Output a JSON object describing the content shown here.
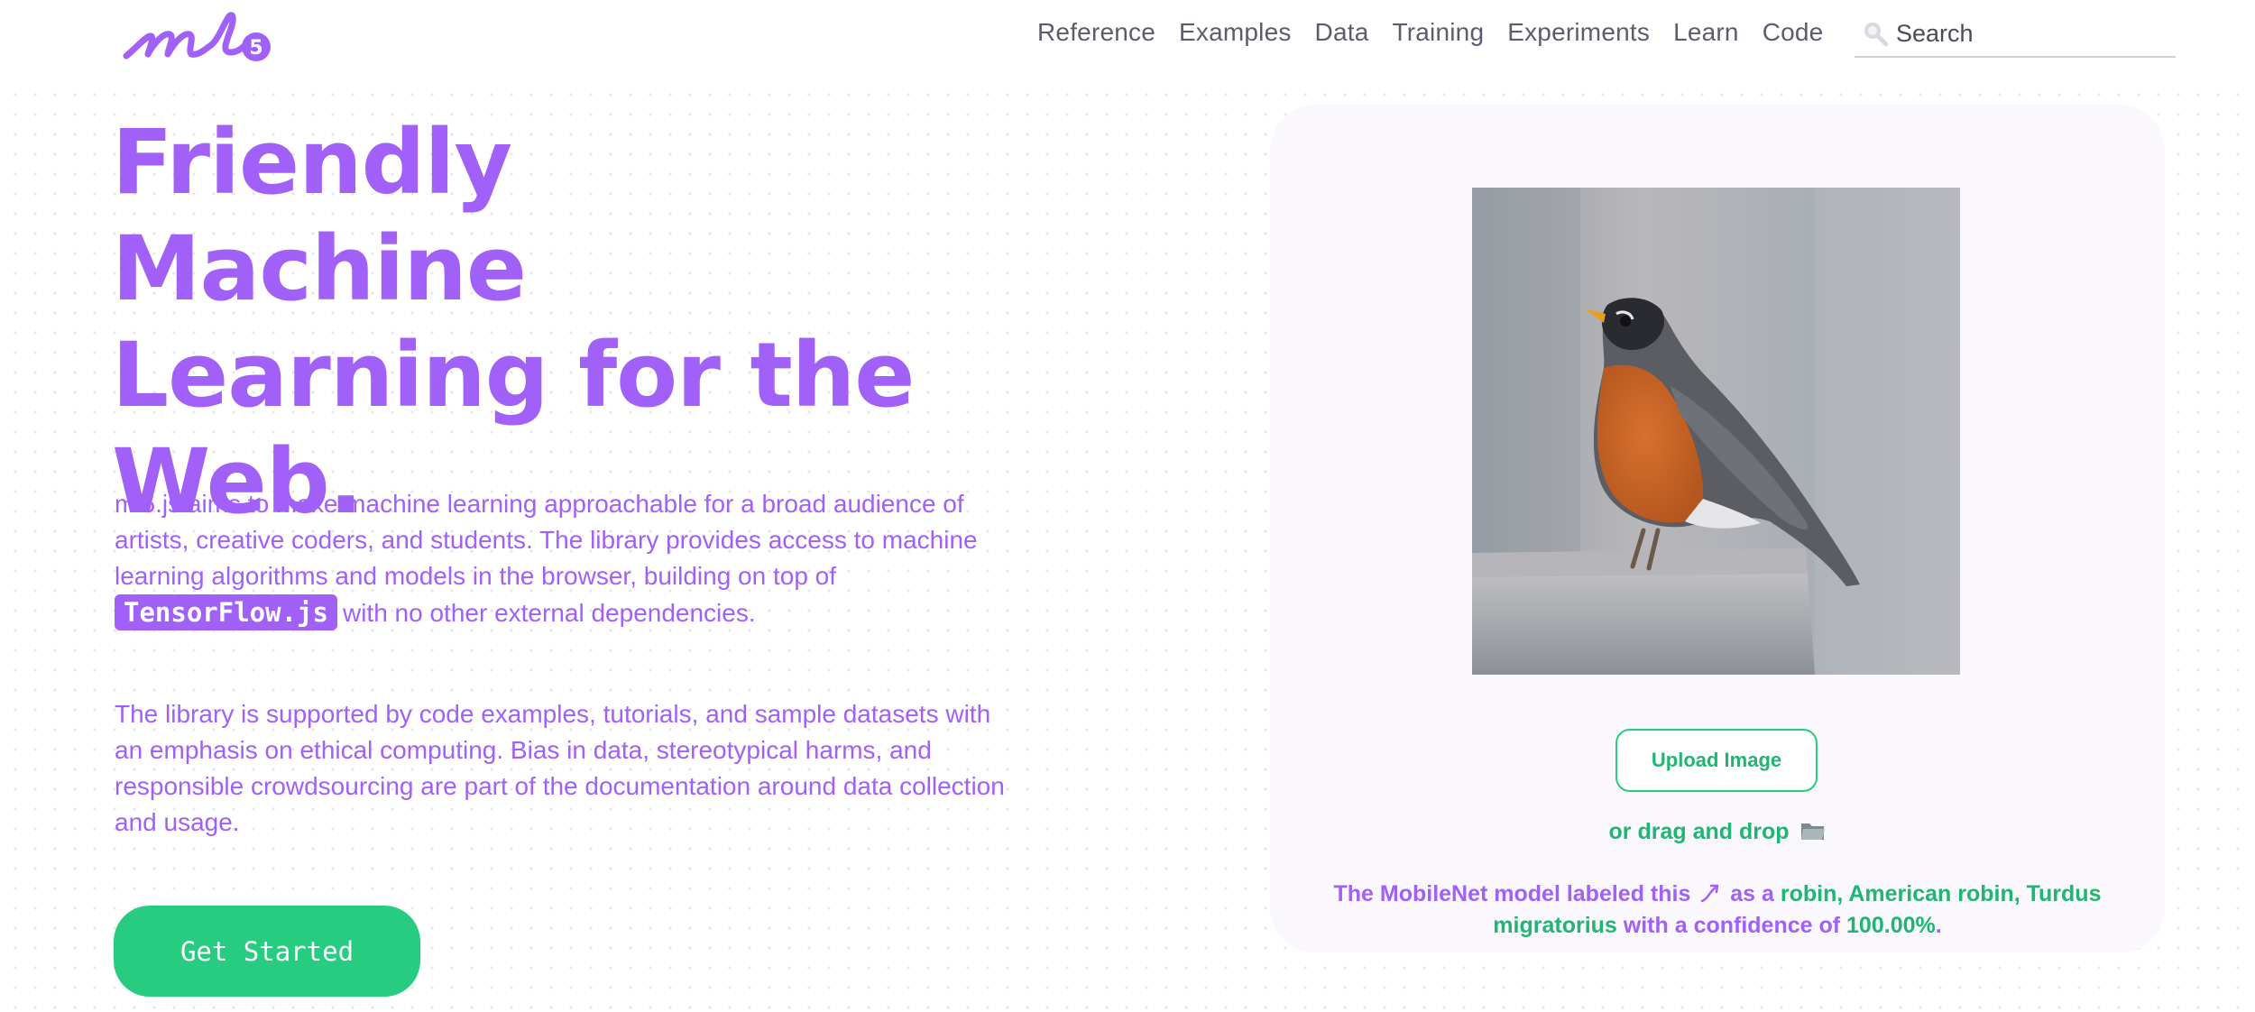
{
  "header": {
    "nav": [
      "Reference",
      "Examples",
      "Data",
      "Training",
      "Experiments",
      "Learn",
      "Code"
    ],
    "search_placeholder": "Search"
  },
  "hero": {
    "title_lines": [
      "Friendly Machine",
      "Learning for the",
      "Web."
    ],
    "paragraph1_before": "ml5.js aims to make machine learning approachable for a broad audience of artists, creative coders, and students. The library provides access to machine learning algorithms and models in the browser, building on top of",
    "paragraph1_badge": "TensorFlow.js",
    "paragraph1_after": "with no other external dependencies.",
    "paragraph2": "The library is supported by code examples, tutorials, and sample datasets with an emphasis on ethical computing. Bias in data, stereotypical harms, and responsible crowdsourcing are part of the documentation around data collection and usage.",
    "cta_label": "Get Started"
  },
  "demo": {
    "upload_label": "Upload Image",
    "drag_label": "or drag and drop",
    "result_prefix": "The MobileNet model labeled this",
    "result_middle": "as a",
    "result_label": "robin, American robin, Turdus migratorius",
    "result_confidence_prefix": "with a confidence of",
    "result_confidence": "100.00%",
    "result_end": "."
  },
  "colors": {
    "brand_purple": "#a160f7",
    "brand_green": "#27cc80"
  },
  "icons": {
    "logo": "ml5-logo",
    "search": "search-icon",
    "folder": "folder-icon",
    "arrow": "curved-arrow-icon"
  }
}
